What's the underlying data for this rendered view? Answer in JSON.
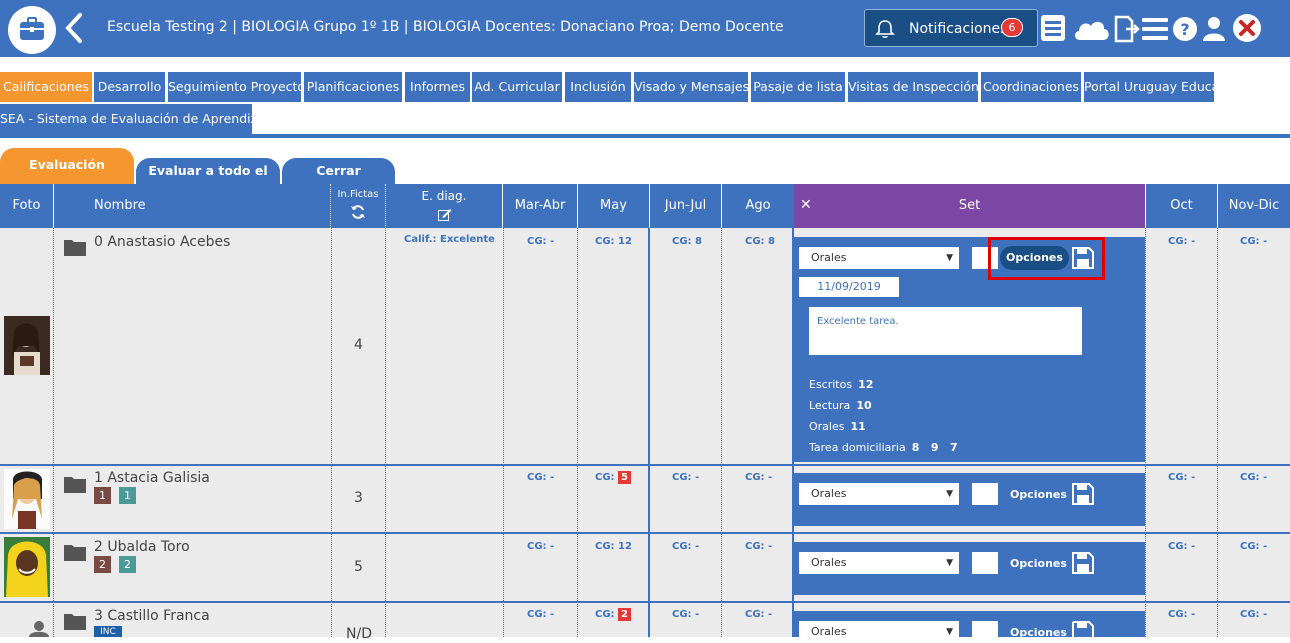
{
  "header": {
    "title": "Escuela Testing 2 | BIOLOGIA Grupo 1º 1B | BIOLOGIA Docentes: Donaciano Proa; Demo Docente",
    "notifications_label": "Notificaciones",
    "notifications_count": "6",
    "icons": [
      "briefcase-icon",
      "back-icon",
      "bell-icon",
      "list-icon",
      "cloud-icon",
      "export-icon",
      "menu-icon",
      "help-icon",
      "user-icon",
      "close-icon"
    ]
  },
  "tabs": [
    "Calificaciones",
    "Desarrollo",
    "Seguimiento Proyecto",
    "Planificaciones",
    "Informes",
    "Ad. Curricular",
    "Inclusión",
    "Visado y Mensajes",
    "Pasaje de lista",
    "Visitas de Inspección",
    "Coordinaciones",
    "Portal Uruguay Educa",
    "SEA - Sistema de Evaluación de Aprendizaje"
  ],
  "subtabs": [
    "Evaluación individual",
    "Evaluar a todo el grupo",
    "Cerrar promedios"
  ],
  "columns": {
    "foto": "Foto",
    "nombre": "Nombre",
    "infictas": "In.Fictas",
    "ediag": "E. diag.",
    "marabr": "Mar-Abr",
    "may": "May",
    "junjul": "Jun-Jul",
    "ago": "Ago",
    "set": "Set",
    "set_close": "✕",
    "oct": "Oct",
    "novdic": "Nov-Dic"
  },
  "students": [
    {
      "name": "0 Anastasio Acebes",
      "infictas": "4",
      "ediag": "Calif.: Excelente",
      "marabr": "CG: -",
      "may": "CG: 12",
      "junjul": "CG: 8",
      "ago": "CG: 8",
      "oct": "CG: -",
      "novdic": "CG: -"
    },
    {
      "name": "1 Astacia Galisia",
      "infictas": "3",
      "badges": [
        "1",
        "1"
      ],
      "marabr": "CG: -",
      "may_prefix": "CG:",
      "may_badge": "5",
      "junjul": "CG: -",
      "ago": "CG: -",
      "oct": "CG: -",
      "novdic": "CG: -"
    },
    {
      "name": "2 Ubalda Toro",
      "infictas": "5",
      "badges": [
        "2",
        "2"
      ],
      "marabr": "CG: -",
      "may": "CG: 12",
      "junjul": "CG: -",
      "ago": "CG: -",
      "oct": "CG: -",
      "novdic": "CG: -"
    },
    {
      "name": "3 Castillo Franca",
      "infictas": "N/D",
      "badges": [
        "INC"
      ],
      "marabr": "CG: -",
      "may_prefix": "CG:",
      "may_badge": "2",
      "junjul": "CG: -",
      "ago": "CG: -",
      "oct": "CG: -",
      "novdic": "CG: -"
    }
  ],
  "set_panel": {
    "select_value": "Orales",
    "options_label": "Opciones",
    "date": "11/09/2019",
    "comment": "Excelente tarea.",
    "stats": [
      {
        "label": "Escritos",
        "values": "12"
      },
      {
        "label": "Lectura",
        "values": "10"
      },
      {
        "label": "Orales",
        "values": "11"
      },
      {
        "label": "Tarea domiciliaria",
        "values": "8   9   7"
      }
    ]
  },
  "colors": {
    "primary": "#3e72be",
    "accent": "#f5962e",
    "set_header": "#7d47a5",
    "badge_red": "#e53935",
    "highlight": "#e00000"
  }
}
